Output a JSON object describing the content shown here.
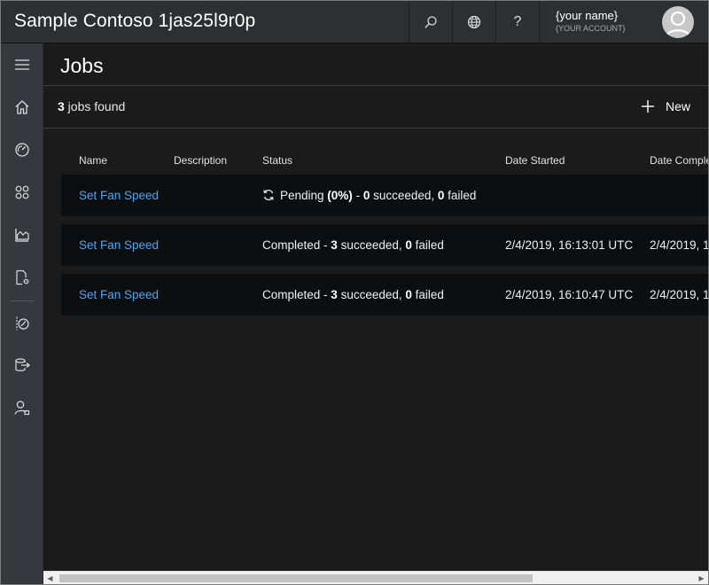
{
  "header": {
    "app_title": "Sample Contoso 1jas25l9r0p",
    "help_label": "?",
    "user_name": "{your name}",
    "user_account": "{YOUR ACCOUNT}"
  },
  "page": {
    "title": "Jobs",
    "jobs_count": "3",
    "jobs_found_suffix": " jobs found",
    "new_label": "New"
  },
  "table": {
    "columns": [
      "Name",
      "Description",
      "Status",
      "Date Started",
      "Date Comple"
    ],
    "rows": [
      {
        "name": "Set Fan Speed",
        "description": "",
        "status_prefix": "Pending ",
        "status_pct": "(0%)",
        "status_mid": " - ",
        "succeeded": "0",
        "succeeded_label": " succeeded, ",
        "failed": "0",
        "failed_label": " failed",
        "date_started": "",
        "date_completed": ""
      },
      {
        "name": "Set Fan Speed",
        "description": "",
        "status_prefix": "Completed - ",
        "succeeded": "3",
        "succeeded_label": " succeeded, ",
        "failed": "0",
        "failed_label": " failed",
        "date_started": "2/4/2019, 16:13:01 UTC",
        "date_completed": "2/4/2019, 1"
      },
      {
        "name": "Set Fan Speed",
        "description": "",
        "status_prefix": "Completed - ",
        "succeeded": "3",
        "succeeded_label": " succeeded, ",
        "failed": "0",
        "failed_label": " failed",
        "date_started": "2/4/2019, 16:10:47 UTC",
        "date_completed": "2/4/2019, 1"
      }
    ]
  },
  "nav": {
    "items": [
      "menu-icon",
      "home-icon",
      "dashboard-icon",
      "devices-icon",
      "analytics-icon",
      "device-templates-icon",
      "jobs-icon",
      "data-export-icon",
      "administration-icon"
    ]
  },
  "colors": {
    "header_bg": "#2d2f33",
    "nav_bg": "#35383d",
    "main_bg": "#1b1b1b",
    "row_bg": "#0d0e10",
    "link": "#4ea3f2"
  }
}
